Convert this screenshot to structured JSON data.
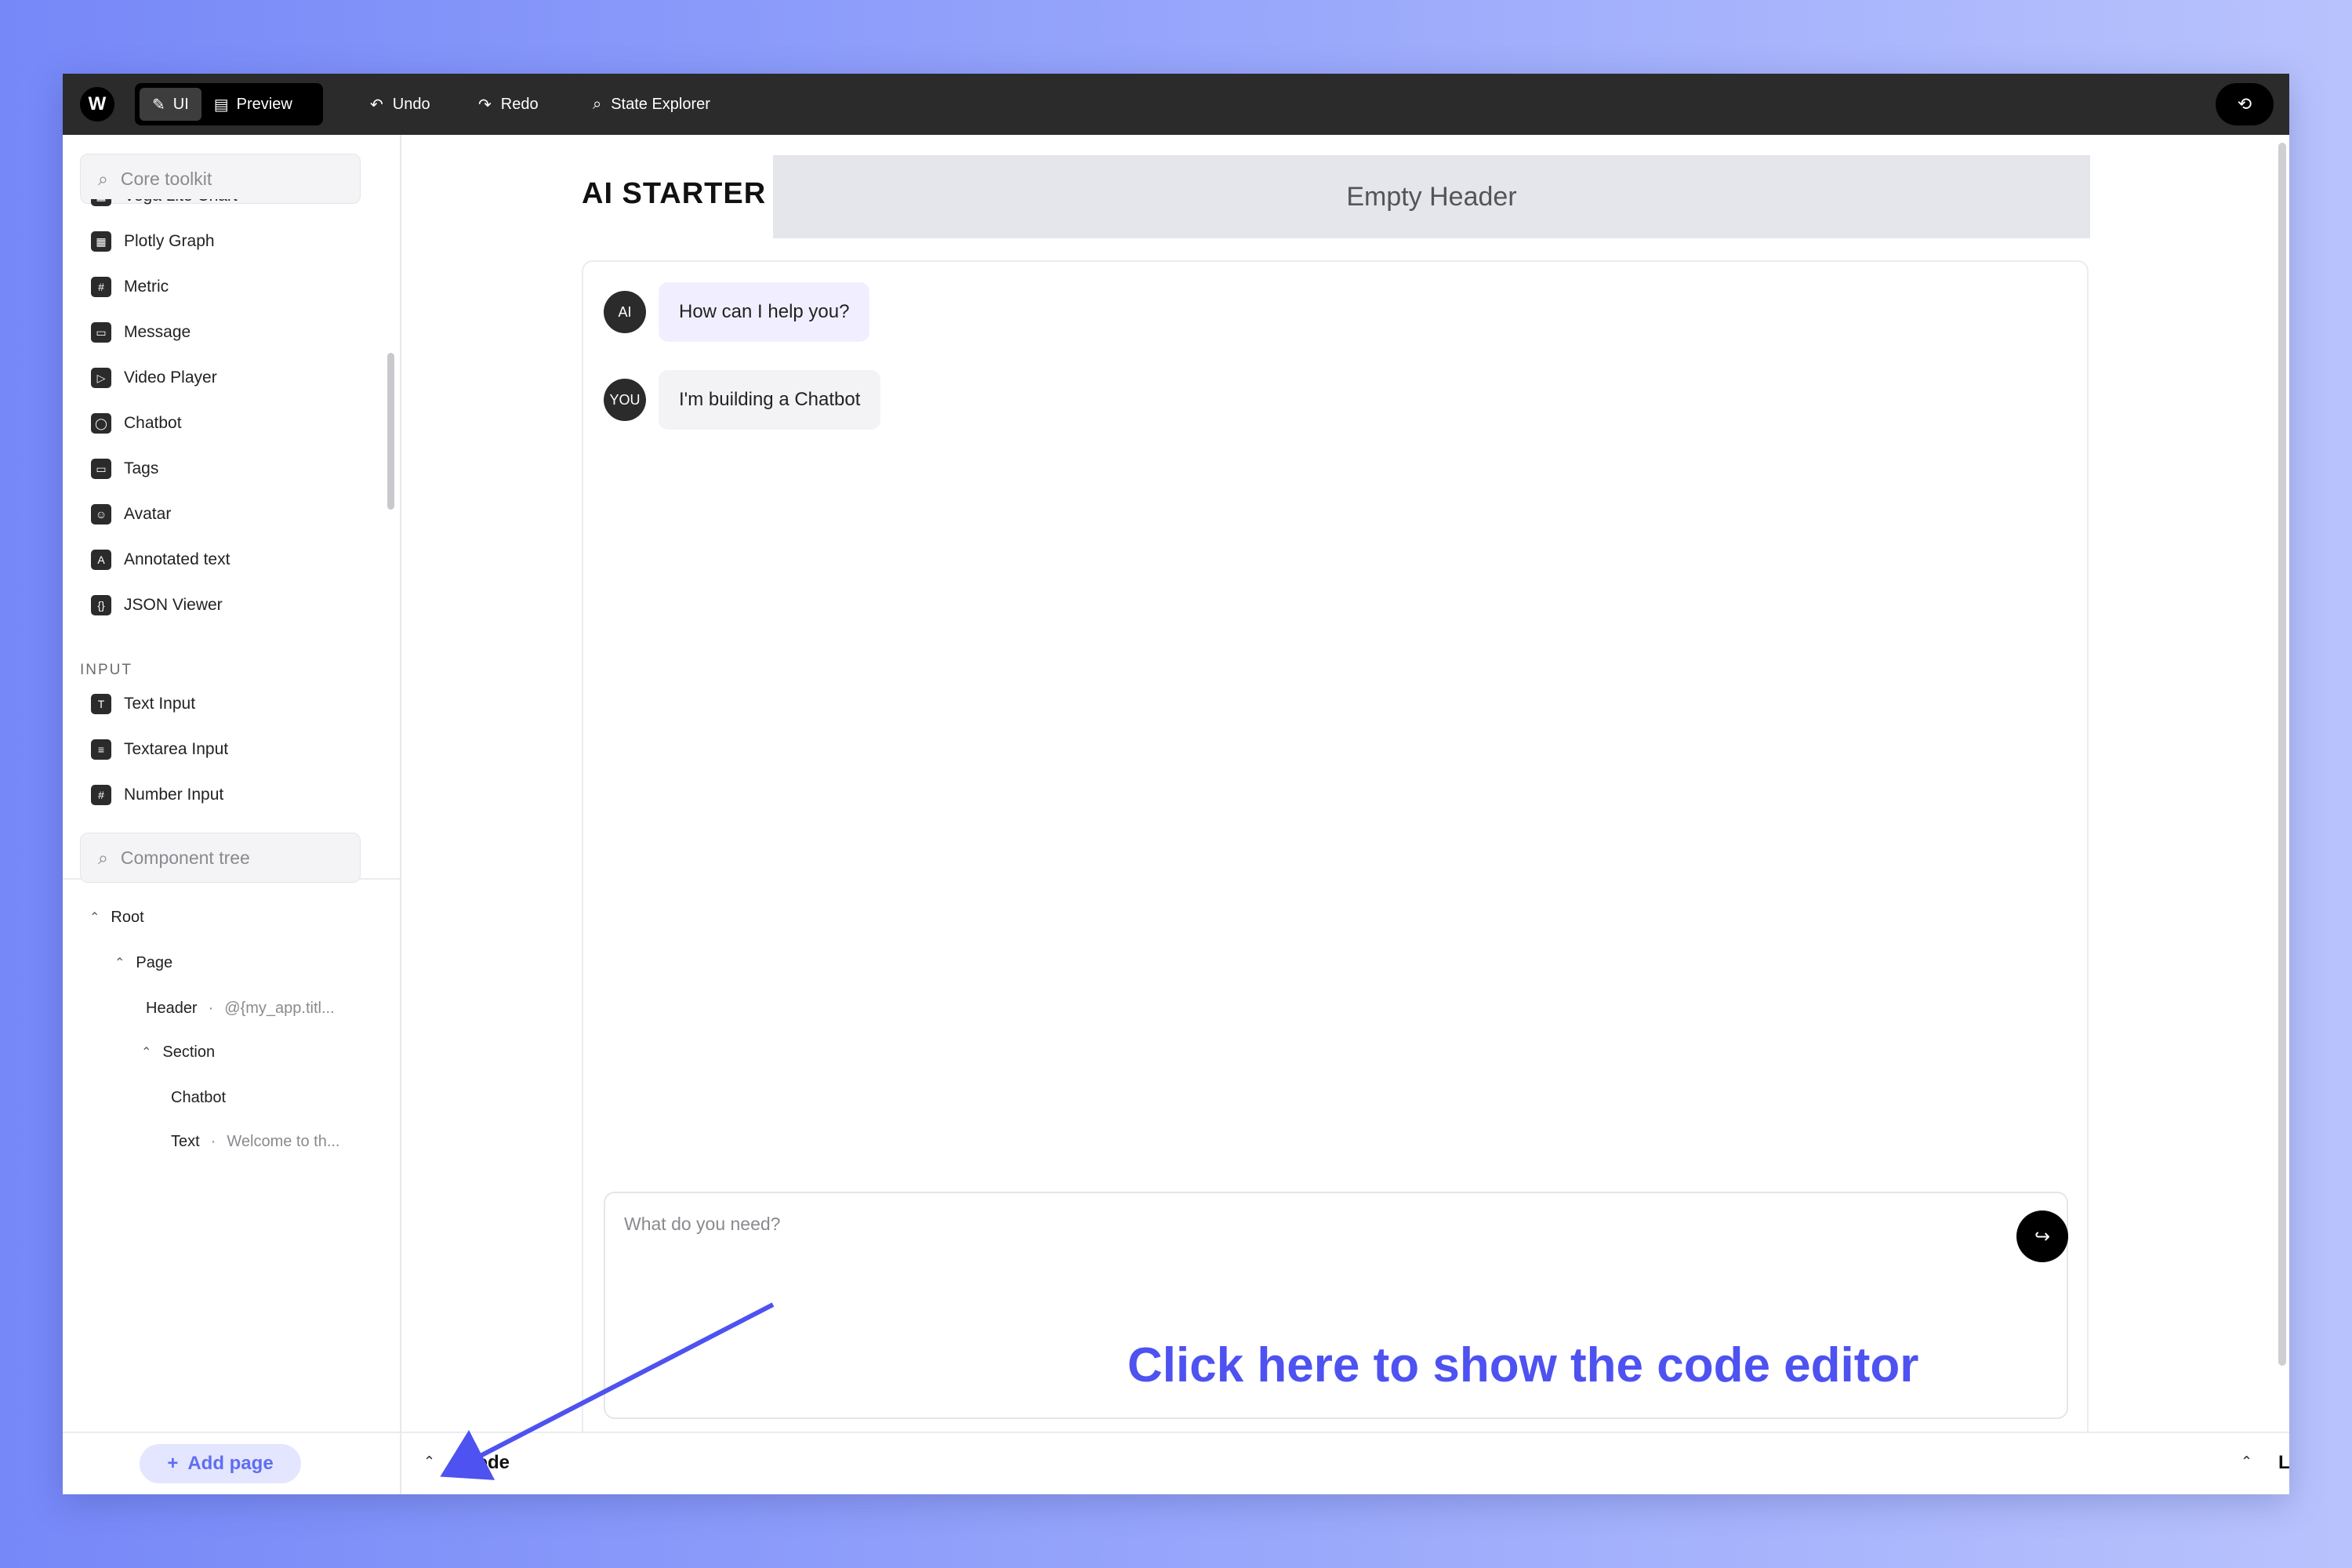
{
  "topbar": {
    "modes": [
      {
        "label": "UI",
        "icon": "pencil-icon",
        "active": true
      },
      {
        "label": "Preview",
        "icon": "preview-icon",
        "active": false
      }
    ],
    "undo_label": "Undo",
    "redo_label": "Redo",
    "state_explorer_label": "State Explorer"
  },
  "sidebar": {
    "toolkit_search_placeholder": "Core toolkit",
    "partial_item": "Vega Lite Chart",
    "toolkit_items": [
      {
        "label": "Plotly Graph",
        "icon": "plotly-icon"
      },
      {
        "label": "Metric",
        "icon": "hash-icon"
      },
      {
        "label": "Message",
        "icon": "message-icon"
      },
      {
        "label": "Video Player",
        "icon": "video-icon"
      },
      {
        "label": "Chatbot",
        "icon": "chatbot-icon"
      },
      {
        "label": "Tags",
        "icon": "tag-icon"
      },
      {
        "label": "Avatar",
        "icon": "avatar-icon"
      },
      {
        "label": "Annotated text",
        "icon": "annotated-text-icon"
      },
      {
        "label": "JSON Viewer",
        "icon": "json-icon"
      }
    ],
    "input_category": "INPUT",
    "input_items": [
      {
        "label": "Text Input",
        "icon": "text-input-icon"
      },
      {
        "label": "Textarea Input",
        "icon": "textarea-icon"
      },
      {
        "label": "Number Input",
        "icon": "number-input-icon"
      }
    ],
    "tree_search_placeholder": "Component tree",
    "tree": [
      {
        "label": "Root",
        "sub": ""
      },
      {
        "label": "Page",
        "sub": ""
      },
      {
        "label": "Header",
        "sub": "@{my_app.titl..."
      },
      {
        "label": "Section",
        "sub": ""
      },
      {
        "label": "Chatbot",
        "sub": ""
      },
      {
        "label": "Text",
        "sub": "Welcome to th..."
      }
    ],
    "add_page_label": "Add page"
  },
  "main": {
    "app_title": "AI STARTER",
    "header_placeholder": "Empty Header",
    "messages": [
      {
        "role": "AI",
        "text": "How can I help you?"
      },
      {
        "role": "YOU",
        "text": "I'm building a Chatbot"
      }
    ],
    "input_placeholder": "What do you need?",
    "annotation": "Click here to show the code editor",
    "code_label": "Code",
    "log_label": "Log"
  }
}
